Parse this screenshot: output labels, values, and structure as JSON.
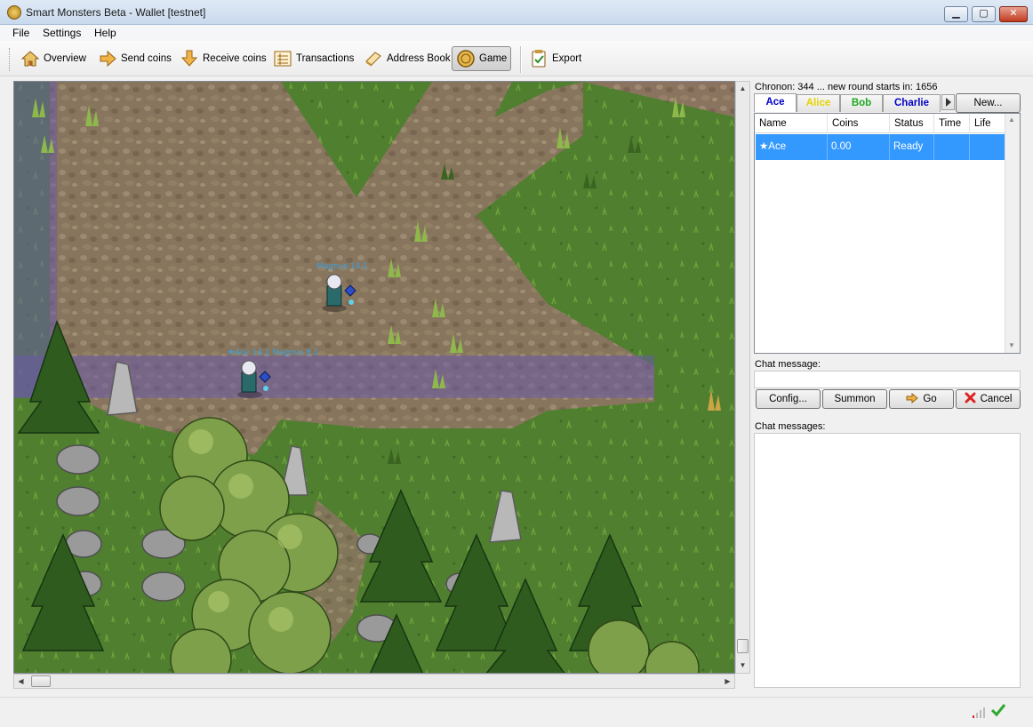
{
  "window": {
    "title": "Smart Monsters Beta - Wallet [testnet]"
  },
  "menu": [
    "File",
    "Settings",
    "Help"
  ],
  "toolbar": {
    "overview": "Overview",
    "send": "Send coins",
    "receive": "Receive coins",
    "transactions": "Transactions",
    "address_book": "Address Book",
    "game": "Game",
    "export": "Export"
  },
  "game_view": {
    "labels": {
      "player_a": "Magnus 14.1",
      "player_b": "★Ace 14.1 Magnus 8.1"
    }
  },
  "panel": {
    "chronon_text": "Chronon: 344 ... new round starts in: 1656",
    "tabs": [
      {
        "label": "Ace",
        "color": "#0000c8"
      },
      {
        "label": "Alice",
        "color": "#e6d200"
      },
      {
        "label": "Bob",
        "color": "#1fa81f"
      },
      {
        "label": "Charlie",
        "color": "#0000c8"
      }
    ],
    "new_button": "New...",
    "table": {
      "columns": [
        "Name",
        "Coins",
        "Status",
        "Time",
        "Life"
      ],
      "rows": [
        {
          "name": "★Ace",
          "coins": "0.00",
          "status": "Ready",
          "time": "",
          "life": ""
        }
      ]
    },
    "chat_message_label": "Chat message:",
    "chat_message_value": "",
    "buttons": {
      "config": "Config...",
      "summon": "Summon",
      "go": "Go",
      "cancel": "Cancel"
    },
    "chat_messages_label": "Chat messages:"
  },
  "colors": {
    "selection": "#3399ff",
    "sync_ok": "#2da82d"
  }
}
